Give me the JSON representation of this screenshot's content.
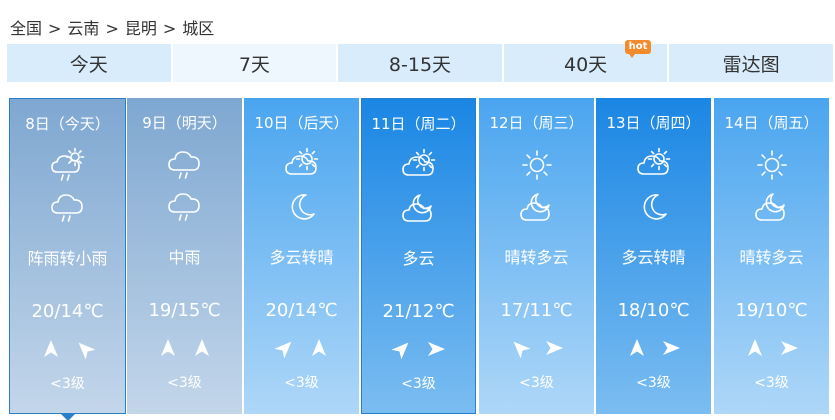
{
  "breadcrumb": {
    "items": [
      "全国",
      "云南",
      "昆明",
      "城区"
    ],
    "separator": ">"
  },
  "tabs": [
    {
      "label": "今天",
      "active": false
    },
    {
      "label": "7天",
      "active": true
    },
    {
      "label": "8-15天",
      "active": false
    },
    {
      "label": "40天",
      "active": false,
      "badge": "hot"
    },
    {
      "label": "雷达图",
      "active": false
    }
  ],
  "colors": {
    "tab_bg": "#d8ecfb",
    "tab_active_bg": "#eef7fe",
    "badge": "#f28a2e",
    "day_backgrounds": [
      [
        "#7ea7d1",
        "#c3d6ea"
      ],
      [
        "#7ea7d1",
        "#c3d6ea"
      ],
      [
        "#4aa5ef",
        "#aed7f8"
      ],
      [
        "#1a86e4",
        "#7bbdf1"
      ],
      [
        "#4aa5ef",
        "#aed7f8"
      ],
      [
        "#1a86e4",
        "#7bbdf1"
      ],
      [
        "#4aa5ef",
        "#aed7f8"
      ]
    ]
  },
  "forecast": [
    {
      "date": "8日（今天）",
      "icon_day": "rain-cloud-sun-icon",
      "icon_night": "rain-cloud-icon",
      "desc": "阵雨转小雨",
      "temp": "20/14℃",
      "wind1": "north-icon",
      "wind2": "northwest-icon",
      "level": "<3级"
    },
    {
      "date": "9日（明天）",
      "icon_day": "rain-cloud-icon",
      "icon_night": "rain-cloud-icon",
      "desc": "中雨",
      "temp": "19/15℃",
      "wind1": "north-icon",
      "wind2": "north-icon",
      "level": "<3级"
    },
    {
      "date": "10日（后天）",
      "icon_day": "partly-cloudy-icon",
      "icon_night": "moon-icon",
      "desc": "多云转晴",
      "temp": "20/14℃",
      "wind1": "northeast-icon",
      "wind2": "north-icon",
      "level": "<3级"
    },
    {
      "date": "11日（周二）",
      "icon_day": "partly-cloudy-icon",
      "icon_night": "moon-cloud-icon",
      "desc": "多云",
      "temp": "21/12℃",
      "wind1": "northeast-icon",
      "wind2": "east-icon",
      "level": "<3级"
    },
    {
      "date": "12日（周三）",
      "icon_day": "sun-icon",
      "icon_night": "moon-cloud-icon",
      "desc": "晴转多云",
      "temp": "17/11℃",
      "wind1": "northwest-icon",
      "wind2": "east-icon",
      "level": "<3级"
    },
    {
      "date": "13日（周四）",
      "icon_day": "partly-cloudy-icon",
      "icon_night": "moon-icon",
      "desc": "多云转晴",
      "temp": "18/10℃",
      "wind1": "north-icon",
      "wind2": "east-icon",
      "level": "<3级"
    },
    {
      "date": "14日（周五）",
      "icon_day": "sun-icon",
      "icon_night": "moon-cloud-icon",
      "desc": "晴转多云",
      "temp": "19/10℃",
      "wind1": "north-icon",
      "wind2": "east-icon",
      "level": "<3级"
    }
  ]
}
